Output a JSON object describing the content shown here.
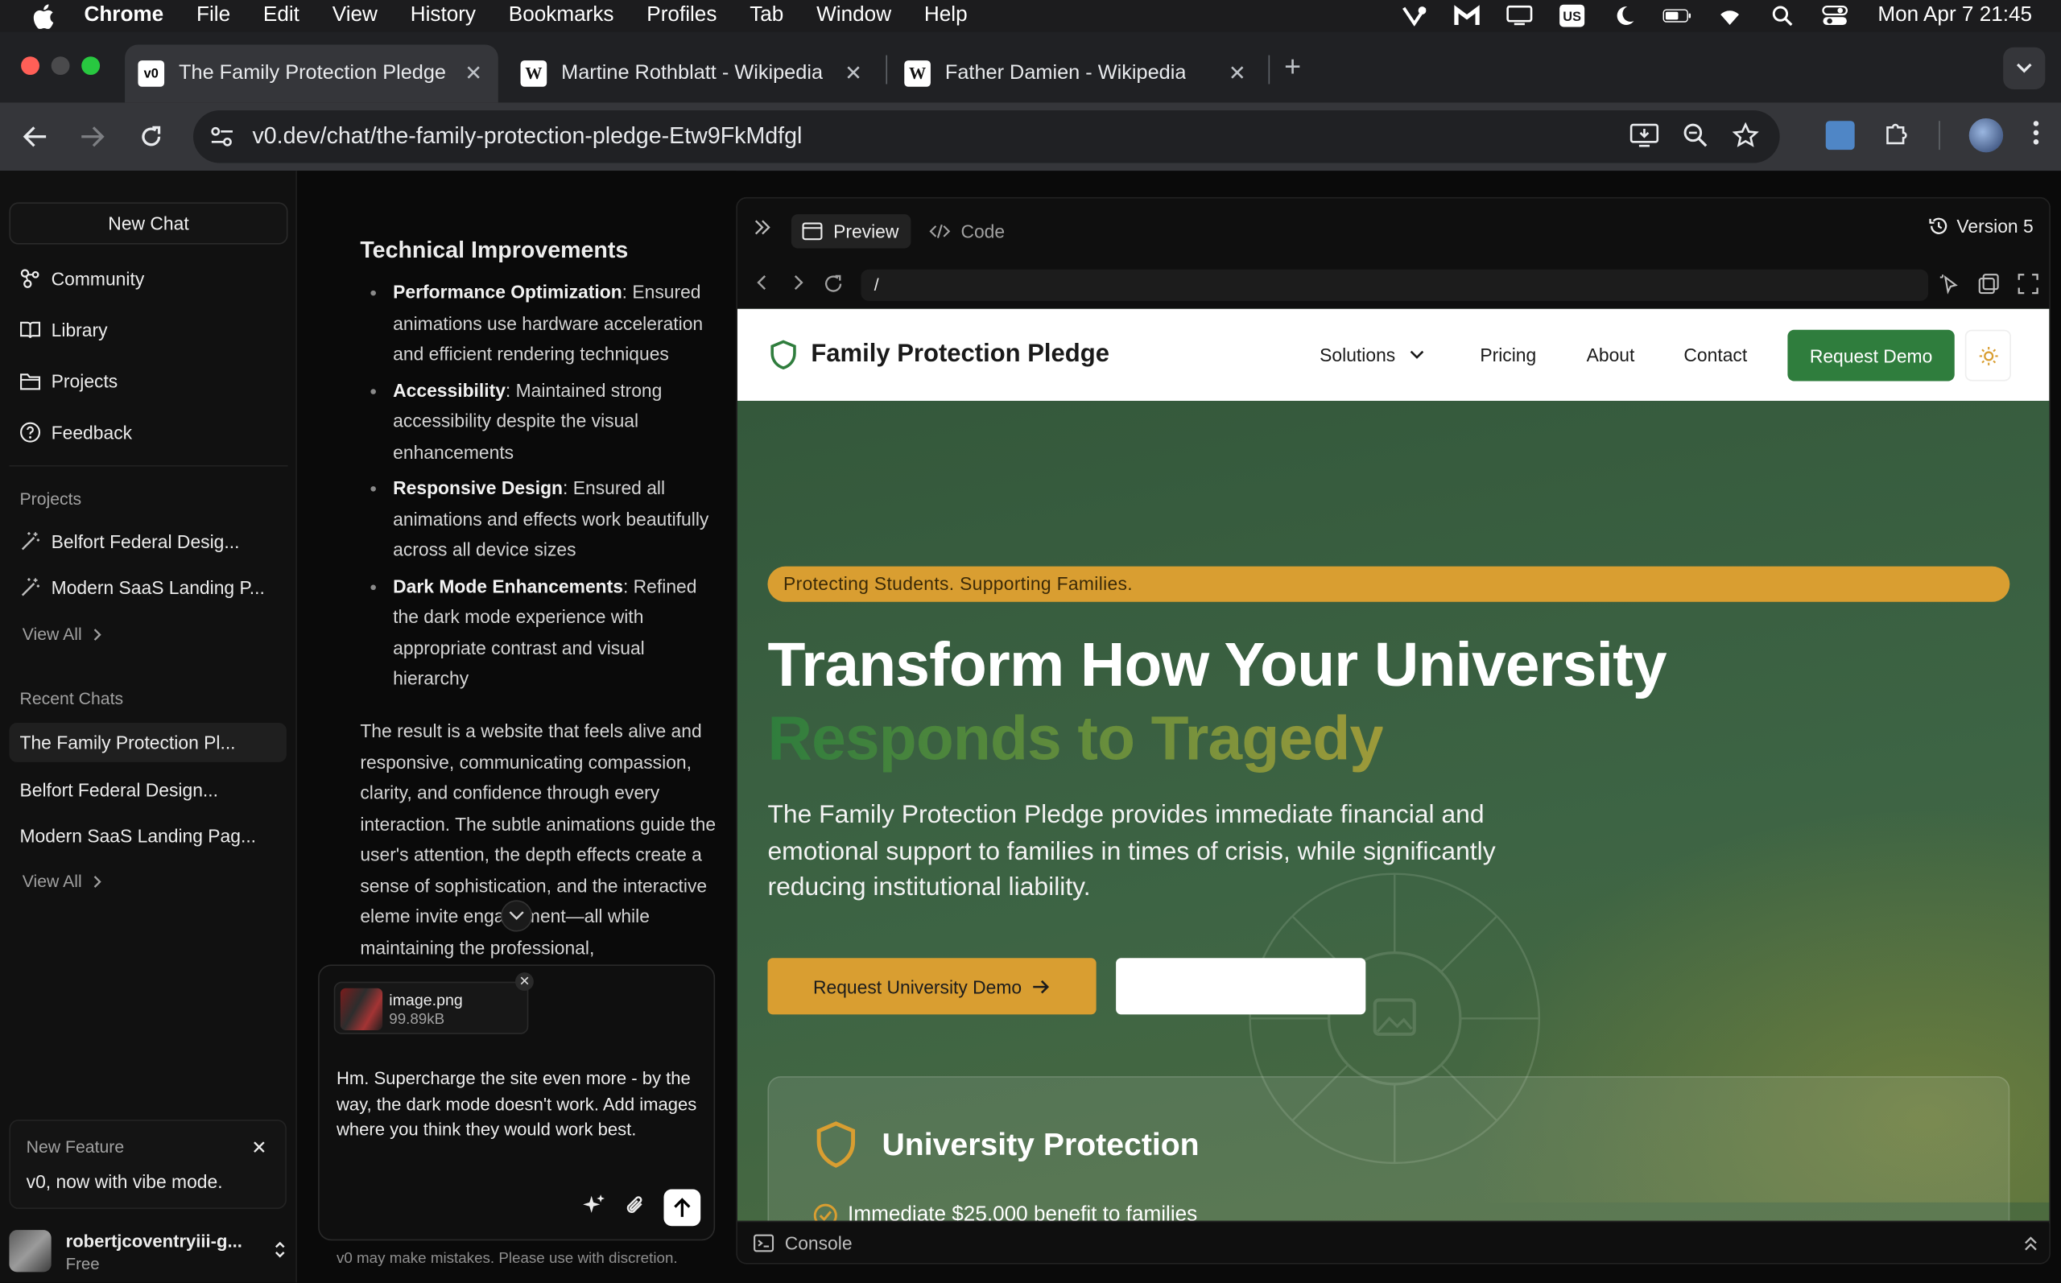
{
  "menubar": {
    "app": "Chrome",
    "items": [
      "File",
      "Edit",
      "View",
      "History",
      "Bookmarks",
      "Profiles",
      "Tab",
      "Window",
      "Help"
    ],
    "clock": "Mon Apr 7  21:45",
    "keyboard_badge": "US"
  },
  "tabs": [
    {
      "title": "The Family Protection Pledge",
      "favicon": "v0-icon",
      "active": true
    },
    {
      "title": "Martine Rothblatt - Wikipedia",
      "favicon": "wikipedia-icon",
      "active": false
    },
    {
      "title": "Father Damien - Wikipedia",
      "favicon": "wikipedia-icon",
      "active": false
    }
  ],
  "address": {
    "url": "v0.dev/chat/the-family-protection-pledge-Etw9FkMdfgl"
  },
  "sidebar": {
    "new_chat": "New Chat",
    "nav": [
      {
        "label": "Community",
        "icon": "community-icon"
      },
      {
        "label": "Library",
        "icon": "book-icon"
      },
      {
        "label": "Projects",
        "icon": "folder-icon"
      },
      {
        "label": "Feedback",
        "icon": "help-icon"
      }
    ],
    "projects_label": "Projects",
    "projects": [
      "Belfort Federal Desig...",
      "Modern SaaS Landing P..."
    ],
    "view_all": "View All",
    "recent_label": "Recent Chats",
    "recent": [
      "The Family Protection Pl...",
      "Belfort Federal Design...",
      "Modern SaaS Landing Pag..."
    ],
    "feature": {
      "title": "New Feature",
      "body": "v0, now with vibe mode."
    },
    "user": {
      "name": "robertjcoventryiii-g...",
      "plan": "Free"
    }
  },
  "chat": {
    "heading": "Technical Improvements",
    "items": [
      {
        "bold": "Performance Optimization",
        "text": ": Ensured animations use hardware acceleration and efficient rendering techniques"
      },
      {
        "bold": "Accessibility",
        "text": ": Maintained strong accessibility despite the visual enhancements"
      },
      {
        "bold": "Responsive Design",
        "text": ": Ensured all animations and effects work beautifully across all device sizes"
      },
      {
        "bold": "Dark Mode Enhancements",
        "text": ": Refined the dark mode experience with appropriate contrast and visual hierarchy"
      }
    ],
    "paragraph": "The result is a website that feels alive and responsive, communicating compassion, clarity, and confidence through every interaction. The subtle animations guide the user's attention, the depth effects create a sense of sophistication, and the interactive eleme   invite engagement—all while maintaining the professional,",
    "attachment": {
      "name": "image.png",
      "size": "99.89kB"
    },
    "composer_text": "Hm. Supercharge the site even more - by the way, the dark mode doesn't work. Add images where you think they would work best.",
    "disclaimer": "v0 may make mistakes. Please use with discretion."
  },
  "panel": {
    "preview_tab": "Preview",
    "code_tab": "Code",
    "version": "Version 5",
    "path": "/",
    "console": "Console"
  },
  "site": {
    "brand": "Family Protection Pledge",
    "nav": [
      "Solutions",
      "Pricing",
      "About",
      "Contact"
    ],
    "cta": "Request Demo",
    "pill": "Protecting Students. Supporting Families.",
    "headline_1": "Transform How Your University",
    "headline_2": "Responds to Tragedy",
    "lede": "The Family Protection Pledge provides immediate financial and emotional support to families in times of crisis, while significantly reducing institutional liability.",
    "primary_cta": "Request University Demo",
    "card_title": "University Protection",
    "card_item": "Immediate $25,000 benefit to families"
  },
  "colors": {
    "brand_green": "#2f7d3d",
    "accent_gold": "#d99e31",
    "hero_bg": "#3b5f41"
  }
}
